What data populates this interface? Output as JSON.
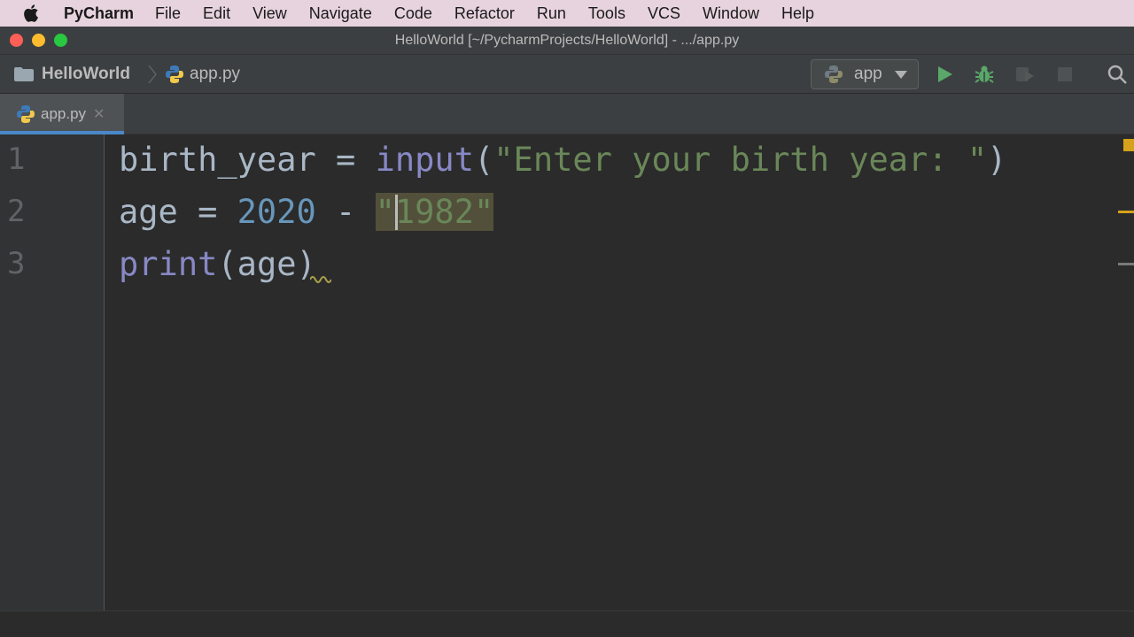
{
  "os_menubar": {
    "app_name": "PyCharm",
    "items": [
      "File",
      "Edit",
      "View",
      "Navigate",
      "Code",
      "Refactor",
      "Run",
      "Tools",
      "VCS",
      "Window",
      "Help"
    ]
  },
  "window": {
    "title": "HelloWorld [~/PycharmProjects/HelloWorld] - .../app.py"
  },
  "navbar": {
    "project": "HelloWorld",
    "file": "app.py",
    "run_config": "app",
    "icons": [
      "run-icon",
      "debug-icon",
      "coverage-icon",
      "stop-icon",
      "search-icon"
    ]
  },
  "tabs": [
    {
      "label": "app.py",
      "active": true
    }
  ],
  "editor": {
    "line_numbers": [
      "1",
      "2",
      "3"
    ],
    "lines": [
      {
        "var": "birth_year",
        "op": " = ",
        "func": "input",
        "open": "(",
        "str": "\"Enter your birth year: \"",
        "close": ")"
      },
      {
        "var": "age",
        "op": " = ",
        "num": "2020",
        "minus": " - ",
        "str_q1": "\"",
        "str_body": "1982\""
      },
      {
        "func": "print",
        "arg": "(age)"
      }
    ]
  },
  "colors": {
    "keyword_builtin": "#8888c6",
    "string": "#6a8759",
    "number": "#6897bb",
    "default_text": "#a9b7c6",
    "accent_tab": "#4a88c7"
  }
}
